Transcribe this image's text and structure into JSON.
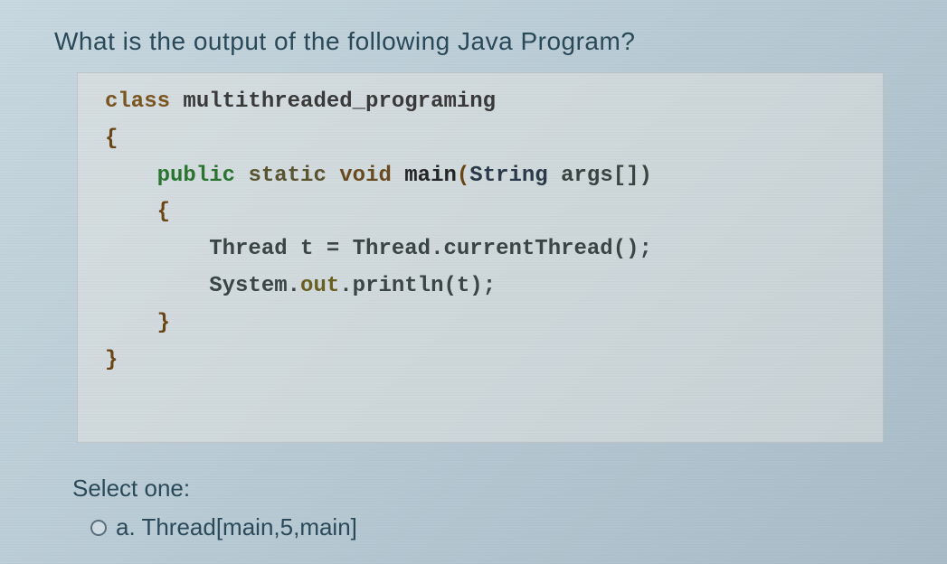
{
  "question": {
    "prompt": "What is the output of the following Java Program?",
    "code": {
      "line1_kw": "class ",
      "line1_name": "multithreaded_programing",
      "line2": "{",
      "line3_pub": "public ",
      "line3_stat": "static ",
      "line3_void": "void ",
      "line3_main": "main",
      "line3_paren_open": "(",
      "line3_string": "String ",
      "line3_args": "args[])",
      "line4": "{",
      "line5a": "Thread t ",
      "line5b": "= Thread.",
      "line5c": "currentThread();",
      "line6a": "System.",
      "line6b": "out",
      "line6c": ".println(t);",
      "line7": "}",
      "line8": "}"
    }
  },
  "answers": {
    "select_label": "Select one:",
    "options": [
      {
        "label": "a.",
        "text": "Thread[main,5,main]"
      }
    ]
  }
}
